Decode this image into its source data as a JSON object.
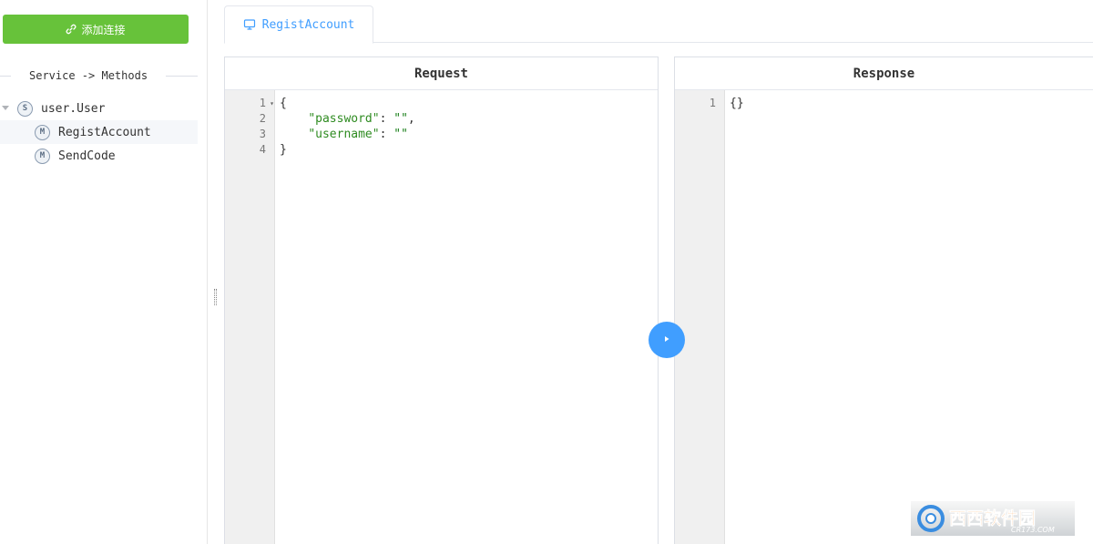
{
  "sidebar": {
    "add_button_label": "添加连接",
    "divider_title": "Service -> Methods",
    "tree": {
      "service": {
        "label": "user.User",
        "badge": "S"
      },
      "methods": [
        {
          "label": "RegistAccount",
          "badge": "M",
          "active": true
        },
        {
          "label": "SendCode",
          "badge": "M",
          "active": false
        }
      ]
    }
  },
  "tabs": [
    {
      "label": "RegistAccount",
      "icon": "monitor-icon",
      "active": true
    }
  ],
  "request": {
    "title": "Request",
    "line_numbers": [
      "1",
      "2",
      "3",
      "4"
    ],
    "code": {
      "line1": "{",
      "line2_key": "\"password\"",
      "line2_sep": ": ",
      "line2_val": "\"\"",
      "line2_end": ",",
      "line3_key": "\"username\"",
      "line3_sep": ": ",
      "line3_val": "\"\"",
      "line4": "}"
    }
  },
  "response": {
    "title": "Response",
    "line_numbers": [
      "1"
    ],
    "code": {
      "line1": "{}"
    }
  },
  "run_button": {
    "icon": "play-icon"
  },
  "watermark": {
    "text": "西西软件园",
    "subtext": "CR173.COM"
  },
  "colors": {
    "add_button": "#67c23a",
    "accent": "#409eff",
    "json_string": "#1a7f1a"
  }
}
